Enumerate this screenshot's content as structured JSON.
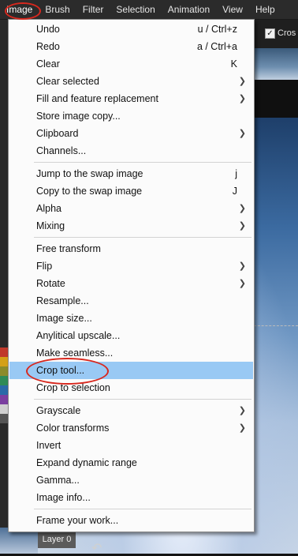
{
  "menubar": {
    "items": [
      {
        "label": "Image"
      },
      {
        "label": "Brush"
      },
      {
        "label": "Filter"
      },
      {
        "label": "Selection"
      },
      {
        "label": "Animation"
      },
      {
        "label": "View"
      },
      {
        "label": "Help"
      }
    ]
  },
  "toolbar": {
    "crosshair_label": "Cros",
    "crosshair_checked": "✓"
  },
  "layer": {
    "label": "Layer 0"
  },
  "colors": {
    "highlight": "#99c9f4",
    "annotation": "#d8281e"
  },
  "menu": {
    "items": [
      {
        "label": "Undo",
        "shortcut": "u / Ctrl+z",
        "submenu": false
      },
      {
        "label": "Redo",
        "shortcut": "a / Ctrl+a",
        "submenu": false
      },
      {
        "label": "Clear",
        "shortcut": "K",
        "submenu": false
      },
      {
        "label": "Clear selected",
        "shortcut": "",
        "submenu": true
      },
      {
        "label": "Fill and feature replacement",
        "shortcut": "",
        "submenu": true
      },
      {
        "label": "Store image copy...",
        "shortcut": "",
        "submenu": false
      },
      {
        "label": "Clipboard",
        "shortcut": "",
        "submenu": true
      },
      {
        "label": "Channels...",
        "shortcut": "",
        "submenu": false
      },
      {
        "label": "Jump to the swap image",
        "shortcut": "j",
        "submenu": false
      },
      {
        "label": "Copy to the swap image",
        "shortcut": "J",
        "submenu": false
      },
      {
        "label": "Alpha",
        "shortcut": "",
        "submenu": true
      },
      {
        "label": "Mixing",
        "shortcut": "",
        "submenu": true
      },
      {
        "label": "Free transform",
        "shortcut": "",
        "submenu": false
      },
      {
        "label": "Flip",
        "shortcut": "",
        "submenu": true
      },
      {
        "label": "Rotate",
        "shortcut": "",
        "submenu": true
      },
      {
        "label": "Resample...",
        "shortcut": "",
        "submenu": false
      },
      {
        "label": "Image size...",
        "shortcut": "",
        "submenu": false
      },
      {
        "label": "Anylitical upscale...",
        "shortcut": "",
        "submenu": false
      },
      {
        "label": "Make seamless...",
        "shortcut": "",
        "submenu": false
      },
      {
        "label": "Crop tool...",
        "shortcut": "",
        "submenu": false,
        "highlighted": true
      },
      {
        "label": "Crop to selection",
        "shortcut": "",
        "submenu": false
      },
      {
        "label": "Grayscale",
        "shortcut": "",
        "submenu": true
      },
      {
        "label": "Color transforms",
        "shortcut": "",
        "submenu": true
      },
      {
        "label": "Invert",
        "shortcut": "",
        "submenu": false
      },
      {
        "label": "Expand dynamic range",
        "shortcut": "",
        "submenu": false
      },
      {
        "label": "Gamma...",
        "shortcut": "",
        "submenu": false
      },
      {
        "label": "Image info...",
        "shortcut": "",
        "submenu": false
      },
      {
        "label": "Frame your work...",
        "shortcut": "",
        "submenu": false
      }
    ]
  }
}
